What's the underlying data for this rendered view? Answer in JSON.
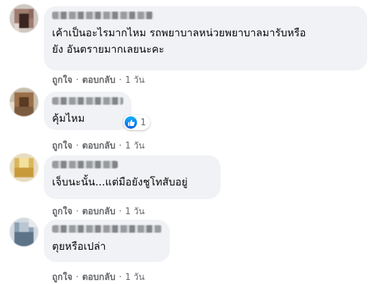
{
  "comments": [
    {
      "text": "เค้าเป็นอะไรมากไหม รถพยาบาลหน่วยพยาบาลมารับหรือ\nยัง อันตรายมากเลยนะคะ",
      "like": "ถูกใจ",
      "reply": "ตอบกลับ",
      "time": "1 วัน"
    },
    {
      "text": "คุ้มไหม",
      "like": "ถูกใจ",
      "reply": "ตอบกลับ",
      "time": "1 วัน",
      "reaction_count": "1"
    },
    {
      "text": "เจ็บนะนั้น...แต่มือยังชูโทสับอยู่",
      "like": "ถูกใจ",
      "reply": "ตอบกลับ",
      "time": "1 วัน"
    },
    {
      "text": "ตุยหรือเปล่า",
      "like": "ถูกใจ",
      "reply": "ตอบกลับ",
      "time": "1 วัน"
    }
  ],
  "separator": "·",
  "colors": {
    "bubble": "#f0f2f5",
    "meta": "#65676b",
    "like_blue": "#1877f2"
  },
  "icons": {
    "reaction": "like-thumb-icon"
  }
}
